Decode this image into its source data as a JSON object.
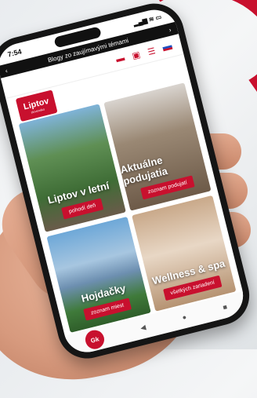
{
  "status": {
    "time": "7:54",
    "icons": "▂▄▆ ≋ ▭"
  },
  "banner": {
    "text": "Blogy zo zaujímavými témami",
    "left": "‹",
    "right": "›"
  },
  "nav": {
    "icon1": "▬",
    "icon2": "▣",
    "icon3": "☰"
  },
  "logo": {
    "title": "Liptov",
    "subtitle": "slovensko"
  },
  "cards": [
    {
      "title": "Liptov v letní",
      "button": "pohodí deň"
    },
    {
      "title": "Aktuálne podujatia",
      "button": "zoznam podujatí"
    },
    {
      "title": "Hojdačky",
      "button": "zoznam miest"
    },
    {
      "title": "Wellness & spa",
      "button": "všetkých zariadení"
    }
  ],
  "bottom": {
    "fab": "Gk",
    "b1": "◀",
    "b2": "●",
    "b3": "■"
  },
  "colors": {
    "brand": "#c8102e"
  }
}
